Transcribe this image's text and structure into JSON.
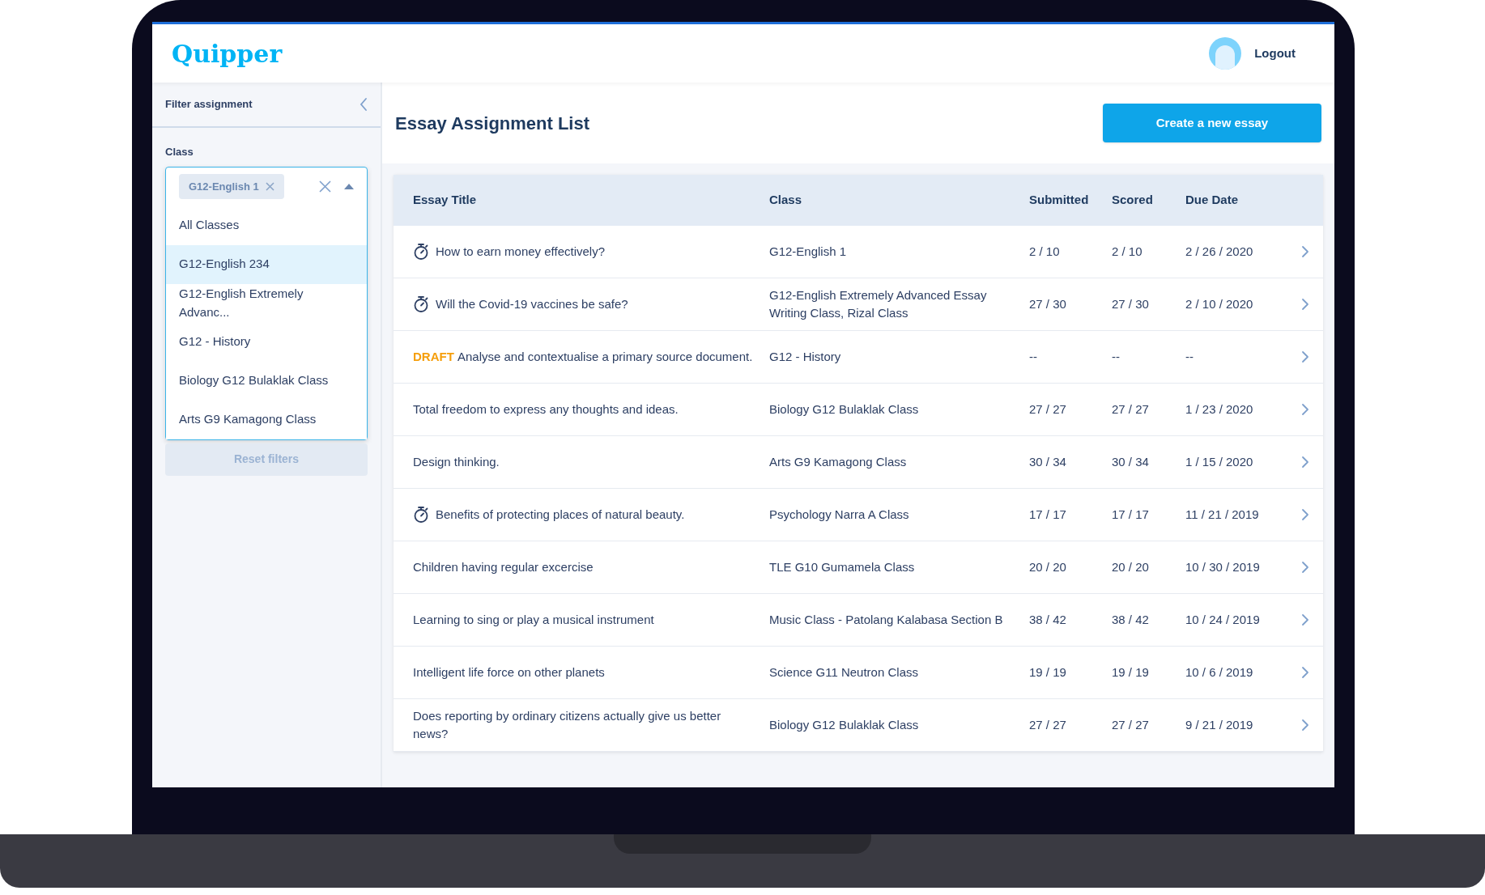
{
  "header": {
    "logo": "Quipper",
    "logout": "Logout"
  },
  "sidebar": {
    "title": "Filter assignment",
    "class_label": "Class",
    "selected_chip": "G12-English 1",
    "options": [
      {
        "label": "All Classes",
        "selected": false
      },
      {
        "label": "G12-English 234",
        "selected": true
      },
      {
        "label": "G12-English Extremely Advanc...",
        "selected": false
      },
      {
        "label": "G12 - History",
        "selected": false
      },
      {
        "label": "Biology G12 Bulaklak Class",
        "selected": false
      },
      {
        "label": "Arts G9 Kamagong Class",
        "selected": false
      }
    ],
    "reset": "Reset filters"
  },
  "main": {
    "title": "Essay Assignment List",
    "create_button": "Create a new essay"
  },
  "table": {
    "columns": [
      "Essay Title",
      "Class",
      "Submitted",
      "Scored",
      "Due Date"
    ],
    "rows": [
      {
        "kind": "timed",
        "title": "How to earn money effectively?",
        "class": "G12-English 1",
        "submitted": "2 / 10",
        "scored": "2 / 10",
        "due": "2 / 26 / 2020"
      },
      {
        "kind": "timed",
        "title": "Will the Covid-19 vaccines be safe?",
        "class": "G12-English Extremely Advanced Essay Writing Class, Rizal Class",
        "submitted": "27 / 30",
        "scored": "27 / 30",
        "due": "2 / 10 / 2020"
      },
      {
        "kind": "draft",
        "draft_label": "DRAFT",
        "title": "Analyse and contextualise a primary source document.",
        "class": "G12 - History",
        "submitted": "--",
        "scored": "--",
        "due": "--"
      },
      {
        "kind": "plain",
        "title": "Total freedom to express any thoughts and ideas.",
        "class": "Biology G12 Bulaklak Class",
        "submitted": "27 / 27",
        "scored": "27 / 27",
        "due": "1 / 23 / 2020"
      },
      {
        "kind": "plain",
        "title": "Design thinking.",
        "class": "Arts G9 Kamagong Class",
        "submitted": "30 / 34",
        "scored": "30 / 34",
        "due": "1 / 15 / 2020"
      },
      {
        "kind": "timed",
        "title": "Benefits of protecting places of natural beauty.",
        "class": "Psychology Narra A Class",
        "submitted": "17 / 17",
        "scored": "17 / 17",
        "due": "11 / 21 / 2019"
      },
      {
        "kind": "plain",
        "title": "Children having regular excercise",
        "class": "TLE G10 Gumamela Class",
        "submitted": "20 / 20",
        "scored": "20 / 20",
        "due": "10 / 30 / 2019"
      },
      {
        "kind": "plain",
        "title": "Learning to sing or play a musical instrument",
        "class": "Music Class - Patolang Kalabasa Section B",
        "submitted": "38 / 42",
        "scored": "38 / 42",
        "due": "10 / 24 / 2019"
      },
      {
        "kind": "plain",
        "title": "Intelligent life force on other planets",
        "class": "Science G11 Neutron Class",
        "submitted": "19 / 19",
        "scored": "19 / 19",
        "due": "10 / 6 / 2019"
      },
      {
        "kind": "plain",
        "title": "Does reporting by ordinary citizens actually give us better news?",
        "class": "Biology G12 Bulaklak Class",
        "submitted": "27 / 27",
        "scored": "27 / 27",
        "due": "9 / 21 / 2019"
      }
    ]
  }
}
